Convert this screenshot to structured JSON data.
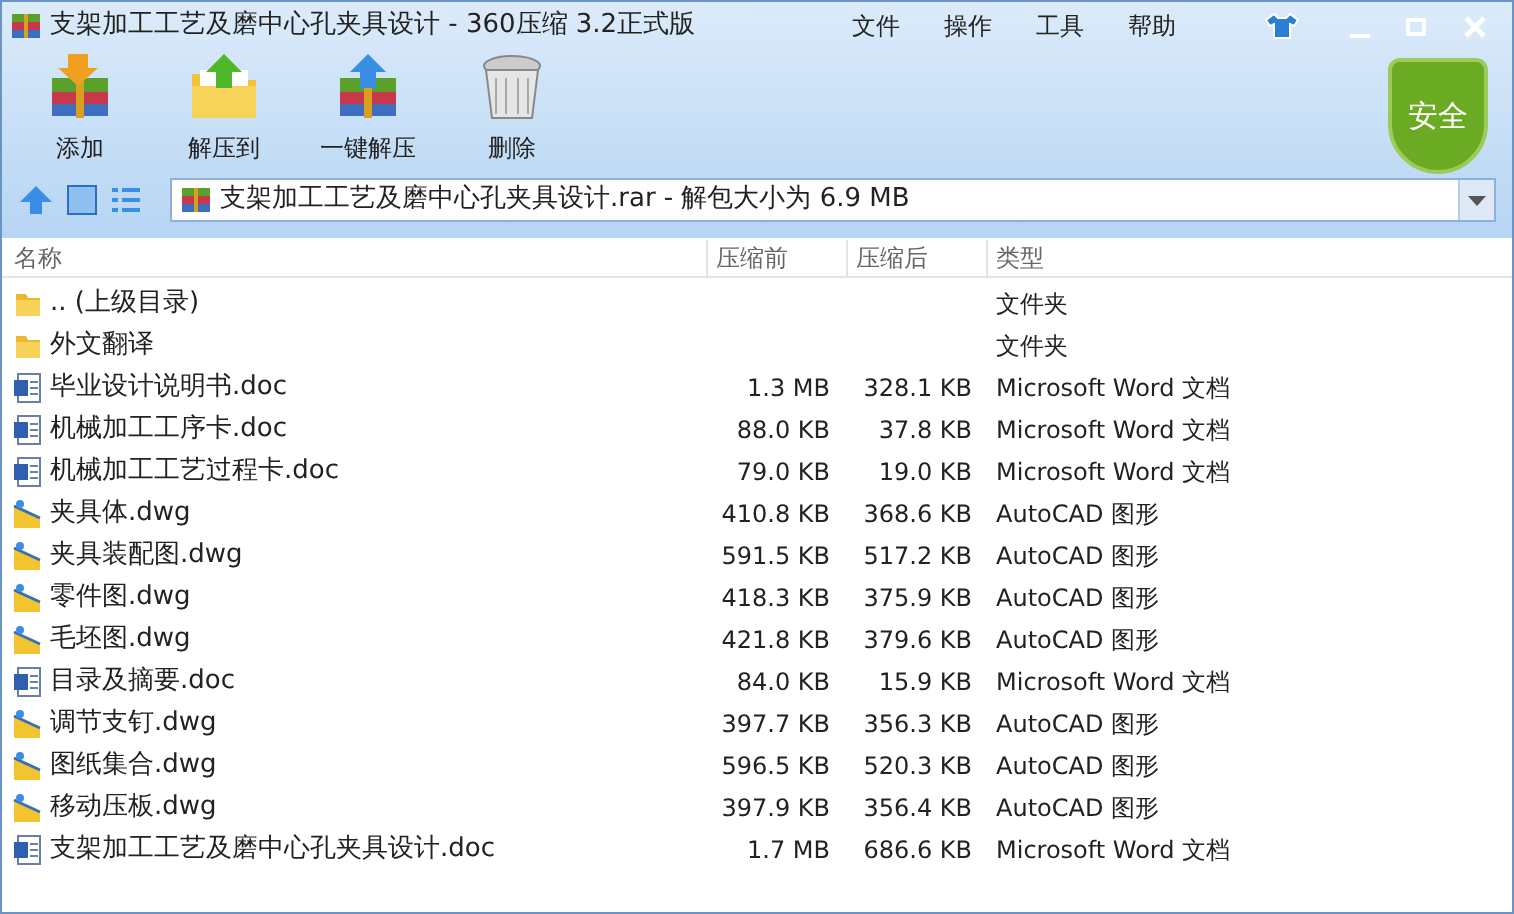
{
  "window": {
    "title": "支架加工工艺及磨中心孔夹具设计 - 360压缩 3.2正式版"
  },
  "menu": [
    "文件",
    "操作",
    "工具",
    "帮助"
  ],
  "toolbar": [
    {
      "kind": "add",
      "label": "添加"
    },
    {
      "kind": "extract",
      "label": "解压到"
    },
    {
      "kind": "oneclick",
      "label": "一键解压"
    },
    {
      "kind": "delete",
      "label": "删除"
    }
  ],
  "security_badge": "安全",
  "address": {
    "value": "支架加工工艺及磨中心孔夹具设计.rar - 解包大小为 6.9 MB"
  },
  "table": {
    "columns": [
      "名称",
      "压缩前",
      "压缩后",
      "类型"
    ],
    "rows": [
      {
        "kind": "folder",
        "name": ".. (上级目录)",
        "before": "",
        "after": "",
        "type": "文件夹"
      },
      {
        "kind": "folder",
        "name": "外文翻译",
        "before": "",
        "after": "",
        "type": "文件夹"
      },
      {
        "kind": "doc",
        "name": "毕业设计说明书.doc",
        "before": "1.3 MB",
        "after": "328.1 KB",
        "type": "Microsoft Word 文档"
      },
      {
        "kind": "doc",
        "name": "机械加工工序卡.doc",
        "before": "88.0 KB",
        "after": "37.8 KB",
        "type": "Microsoft Word 文档"
      },
      {
        "kind": "doc",
        "name": "机械加工工艺过程卡.doc",
        "before": "79.0 KB",
        "after": "19.0 KB",
        "type": "Microsoft Word 文档"
      },
      {
        "kind": "dwg",
        "name": "夹具体.dwg",
        "before": "410.8 KB",
        "after": "368.6 KB",
        "type": "AutoCAD 图形"
      },
      {
        "kind": "dwg",
        "name": "夹具装配图.dwg",
        "before": "591.5 KB",
        "after": "517.2 KB",
        "type": "AutoCAD 图形"
      },
      {
        "kind": "dwg",
        "name": "零件图.dwg",
        "before": "418.3 KB",
        "after": "375.9 KB",
        "type": "AutoCAD 图形"
      },
      {
        "kind": "dwg",
        "name": "毛坯图.dwg",
        "before": "421.8 KB",
        "after": "379.6 KB",
        "type": "AutoCAD 图形"
      },
      {
        "kind": "doc",
        "name": "目录及摘要.doc",
        "before": "84.0 KB",
        "after": "15.9 KB",
        "type": "Microsoft Word 文档"
      },
      {
        "kind": "dwg",
        "name": "调节支钉.dwg",
        "before": "397.7 KB",
        "after": "356.3 KB",
        "type": "AutoCAD 图形"
      },
      {
        "kind": "dwg",
        "name": "图纸集合.dwg",
        "before": "596.5 KB",
        "after": "520.3 KB",
        "type": "AutoCAD 图形"
      },
      {
        "kind": "dwg",
        "name": "移动压板.dwg",
        "before": "397.9 KB",
        "after": "356.4 KB",
        "type": "AutoCAD 图形"
      },
      {
        "kind": "doc",
        "name": "支架加工工艺及磨中心孔夹具设计.doc",
        "before": "1.7 MB",
        "after": "686.6 KB",
        "type": "Microsoft Word 文档"
      }
    ]
  }
}
